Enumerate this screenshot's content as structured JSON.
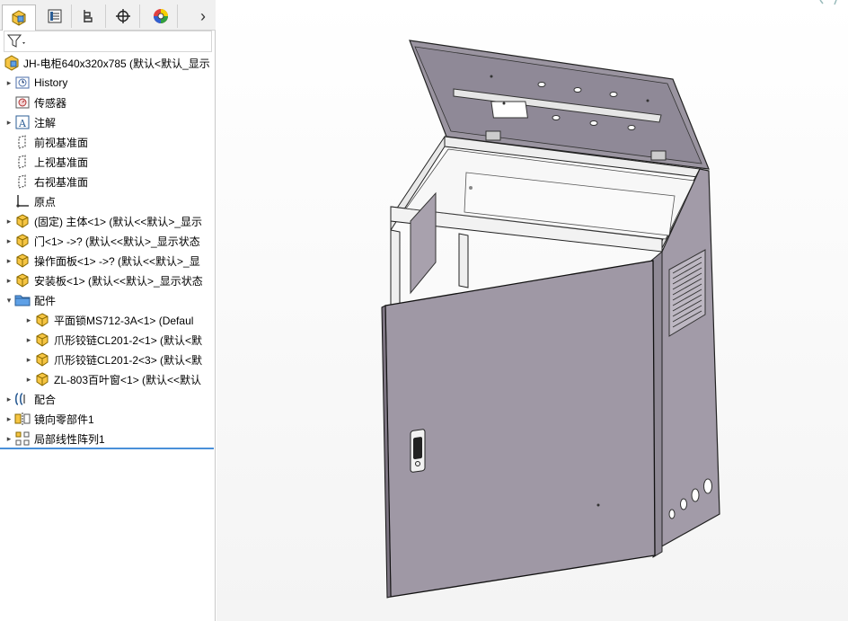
{
  "tree_root": "JH-电柜640x320x785  (默认<默认_显示",
  "items": [
    {
      "label": "History",
      "indent": 0,
      "arrow": "▸",
      "icon": "history-icon"
    },
    {
      "label": "传感器",
      "indent": 0,
      "arrow": "",
      "icon": "sensor-icon"
    },
    {
      "label": "注解",
      "indent": 0,
      "arrow": "▸",
      "icon": "annotation-icon"
    },
    {
      "label": "前视基准面",
      "indent": 0,
      "arrow": "",
      "icon": "plane-icon"
    },
    {
      "label": "上视基准面",
      "indent": 0,
      "arrow": "",
      "icon": "plane-icon"
    },
    {
      "label": "右视基准面",
      "indent": 0,
      "arrow": "",
      "icon": "plane-icon"
    },
    {
      "label": "原点",
      "indent": 0,
      "arrow": "",
      "icon": "origin-icon"
    },
    {
      "label": "(固定) 主体<1> (默认<<默认>_显示",
      "indent": 0,
      "arrow": "▸",
      "icon": "part-icon"
    },
    {
      "label": "门<1> ->? (默认<<默认>_显示状态",
      "indent": 0,
      "arrow": "▸",
      "icon": "part-icon"
    },
    {
      "label": "操作面板<1> ->? (默认<<默认>_显",
      "indent": 0,
      "arrow": "▸",
      "icon": "part-icon"
    },
    {
      "label": "安装板<1> (默认<<默认>_显示状态",
      "indent": 0,
      "arrow": "▸",
      "icon": "part-icon"
    },
    {
      "label": "配件",
      "indent": 0,
      "arrow": "▾",
      "icon": "folder-icon"
    },
    {
      "label": "平面锁MS712-3A<1> (Defaul",
      "indent": 1,
      "arrow": "▸",
      "icon": "part-icon"
    },
    {
      "label": "爪形铰链CL201-2<1> (默认<默",
      "indent": 1,
      "arrow": "▸",
      "icon": "part-icon"
    },
    {
      "label": "爪形铰链CL201-2<3> (默认<默",
      "indent": 1,
      "arrow": "▸",
      "icon": "part-icon"
    },
    {
      "label": "ZL-803百叶窗<1> (默认<<默认",
      "indent": 1,
      "arrow": "▸",
      "icon": "part-icon"
    },
    {
      "label": "配合",
      "indent": 0,
      "arrow": "▸",
      "icon": "mate-icon"
    },
    {
      "label": "镜向零部件1",
      "indent": 0,
      "arrow": "▸",
      "icon": "mirror-icon"
    },
    {
      "label": "局部线性阵列1",
      "indent": 0,
      "arrow": "▸",
      "icon": "pattern-icon"
    }
  ],
  "tab_expand": "›",
  "colors": {
    "cabinet": "#9e96a2",
    "cabinet_dark": "#7d7582",
    "frame": "#e9e9e9",
    "accent": "#4a90d9"
  }
}
